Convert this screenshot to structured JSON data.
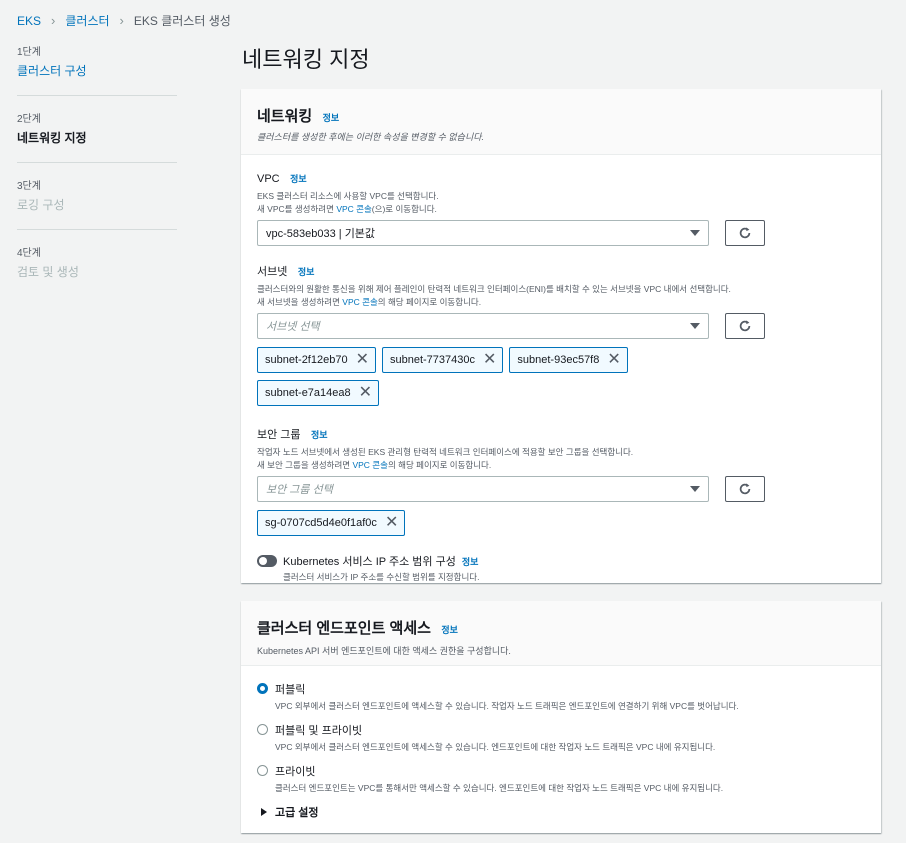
{
  "breadcrumb": {
    "items": [
      "EKS",
      "클러스터",
      "EKS 클러스터 생성"
    ]
  },
  "steps": [
    {
      "num": "1단계",
      "label": "클러스터 구성",
      "state": "done"
    },
    {
      "num": "2단계",
      "label": "네트워킹 지정",
      "state": "active"
    },
    {
      "num": "3단계",
      "label": "로깅 구성",
      "state": "disabled"
    },
    {
      "num": "4단계",
      "label": "검토 및 생성",
      "state": "disabled"
    }
  ],
  "page_title": "네트워킹 지정",
  "networking": {
    "title": "네트워킹",
    "info": "정보",
    "desc": "클러스터를 생성한 후에는 이러한 속성을 변경할 수 없습니다.",
    "vpc": {
      "label": "VPC",
      "info": "정보",
      "desc1": "EKS 클러스터 리소스에 사용할 VPC를 선택합니다.",
      "desc2_pre": "새 VPC를 생성하려면 ",
      "desc2_link": "VPC 콘솔",
      "desc2_post": "(으)로 이동합니다.",
      "value": "vpc-583eb033 | 기본값"
    },
    "subnet": {
      "label": "서브넷",
      "info": "정보",
      "desc1": "클러스터와의 원활한 통신을 위해 제어 플레인이 탄력적 네트워크 인터페이스(ENI)를 배치할 수 있는 서브넷을 VPC 내에서 선택합니다.",
      "desc2_pre": "새 서브넷을 생성하려면 ",
      "desc2_link": "VPC 콘솔",
      "desc2_post": "의 해당 페이지로 이동합니다.",
      "placeholder": "서브넷 선택",
      "tags": [
        "subnet-2f12eb70",
        "subnet-7737430c",
        "subnet-93ec57f8",
        "subnet-e7a14ea8"
      ]
    },
    "sg": {
      "label": "보안 그룹",
      "info": "정보",
      "desc1": "작업자 노드 서브넷에서 생성된 EKS 관리형 탄력적 네트워크 인터페이스에 적용할 보안 그룹을 선택합니다.",
      "desc2_pre": "새 보안 그룹을 생성하려면 ",
      "desc2_link": "VPC 콘솔",
      "desc2_post": "의 해당 페이지로 이동합니다.",
      "placeholder": "보안 그룹 선택",
      "tags": [
        "sg-0707cd5d4e0f1af0c"
      ]
    },
    "k8s": {
      "label": "Kubernetes 서비스 IP 주소 범위 구성",
      "info": "정보",
      "desc": "클러스터 서비스가 IP 주소를 수신할 범위를 지정합니다.",
      "enabled": false
    }
  },
  "endpoint": {
    "title": "클러스터 엔드포인트 액세스",
    "info": "정보",
    "desc": "Kubernetes API 서버 엔드포인트에 대한 액세스 권한을 구성합니다.",
    "options": [
      {
        "label": "퍼블릭",
        "desc": "VPC 외부에서 클러스터 엔드포인트에 액세스할 수 있습니다. 작업자 노드 트래픽은 엔드포인트에 연결하기 위해 VPC를 벗어납니다.",
        "selected": true
      },
      {
        "label": "퍼블릭 및 프라이빗",
        "desc": "VPC 외부에서 클러스터 엔드포인트에 액세스할 수 있습니다. 엔드포인트에 대한 작업자 노드 트래픽은 VPC 내에 유지됩니다.",
        "selected": false
      },
      {
        "label": "프라이빗",
        "desc": "클러스터 엔드포인트는 VPC를 통해서만 액세스할 수 있습니다. 엔드포인트에 대한 작업자 노드 트래픽은 VPC 내에 유지됩니다.",
        "selected": false
      }
    ],
    "advanced": "고급 설정"
  }
}
